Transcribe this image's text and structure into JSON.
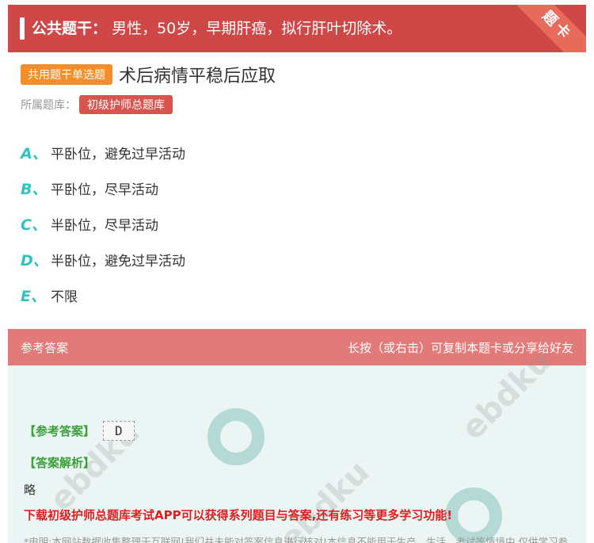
{
  "banner": {
    "label": "公共题干：",
    "text": "男性，50岁，早期肝癌，拟行肝叶切除术。",
    "corner_tag": "题卡"
  },
  "question": {
    "type_tag": "共用题干单选题",
    "title": "术后病情平稳后应取",
    "bank_label": "所属题库：",
    "bank_name": "初级护师总题库",
    "options": [
      {
        "letter": "A、",
        "text": "平卧位，避免过早活动"
      },
      {
        "letter": "B、",
        "text": "平卧位，尽早活动"
      },
      {
        "letter": "C、",
        "text": "半卧位，尽早活动"
      },
      {
        "letter": "D、",
        "text": "半卧位，避免过早活动"
      },
      {
        "letter": "E、",
        "text": "不限"
      }
    ]
  },
  "answer": {
    "header_left": "参考答案",
    "header_right": "长按（或右击）可复制本题卡或分享给好友",
    "answer_label": "【参考答案】",
    "answer_value": "D",
    "explain_label": "【答案解析】",
    "explain_text": "略",
    "promo": "下载初级护师总题库考试APP可以获得系列题目与答案,还有练习等更多学习功能!",
    "disclaimer": "*申明:本网站数据收集整理于互联网!我们并未能对答案信息进行核对!本信息不能用于生产、生活、考试等情境中,仅供学习参考！由此产生任何后果本站不承担责任!"
  },
  "colors": {
    "banner_red": "#cf4747",
    "type_orange": "#f58d2a",
    "option_teal": "#33c2c2",
    "answer_green": "#3aa03a",
    "promo_red": "#e02020"
  }
}
